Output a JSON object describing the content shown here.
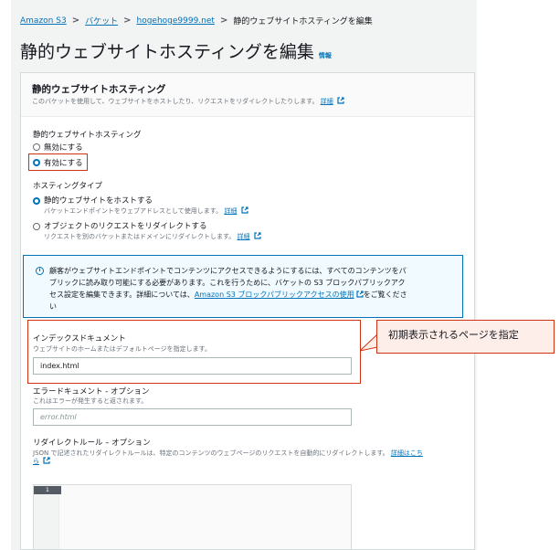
{
  "breadcrumb": {
    "items": [
      "Amazon S3",
      "バケット",
      "hogehoge9999.net"
    ],
    "current": "静的ウェブサイトホスティングを編集"
  },
  "page_title": "静的ウェブサイトホスティングを編集",
  "info_link": "情報",
  "panel": {
    "title": "静的ウェブサイトホスティング",
    "description": "このバケットを使用して、ウェブサイトをホストしたり、リクエストをリダイレクトしたりします。",
    "detail_link": "詳細"
  },
  "hosting": {
    "label": "静的ウェブサイトホスティング",
    "options": [
      "無効にする",
      "有効にする"
    ],
    "selected": "有効にする"
  },
  "hosting_type": {
    "label": "ホスティングタイプ",
    "options": [
      {
        "label": "静的ウェブサイトをホストする",
        "desc": "バケットエンドポイントをウェブアドレスとして使用します。",
        "link": "詳細",
        "selected": true
      },
      {
        "label": "オブジェクトのリクエストをリダイレクトする",
        "desc": "リクエストを別のバケットまたはドメインにリダイレクトします。",
        "link": "詳細",
        "selected": false
      }
    ]
  },
  "alert": {
    "line1": "顧客がウェブサイトエンドポイントでコンテンツにアクセスできるようにするには、すべてのコンテンツをパ",
    "line2": "ブリックに読み取り可能にする必要があります。これを行うために、バケットの S3 ブロックパブリックアク",
    "line3": "セス設定を編集できます。詳細については、",
    "link": "Amazon S3 ブロックパブリックアクセスの使用",
    "line3_end": "をご覧くださ",
    "line4": "い"
  },
  "index_document": {
    "label": "インデックスドキュメント",
    "desc": "ウェブサイトのホームまたはデフォルトページを指定します。",
    "value": "index.html"
  },
  "error_document": {
    "label": "エラードキュメント - オプション",
    "desc": "これはエラーが発生すると返されます。",
    "placeholder": "error.html"
  },
  "redirect_rules": {
    "label": "リダイレクトルール – オプション",
    "desc": "JSON で記述されたリダイレクトルールは、特定のコンテンツのウェブページのリクエストを自動的にリダイレクトします。",
    "link_a": "詳細はこち",
    "link_b": "ら",
    "line_number": "1"
  },
  "callout_text": "初期表示されるページを指定",
  "colors": {
    "accent": "#0073bb",
    "highlight": "#d13212",
    "background": "#f2f3f3"
  }
}
